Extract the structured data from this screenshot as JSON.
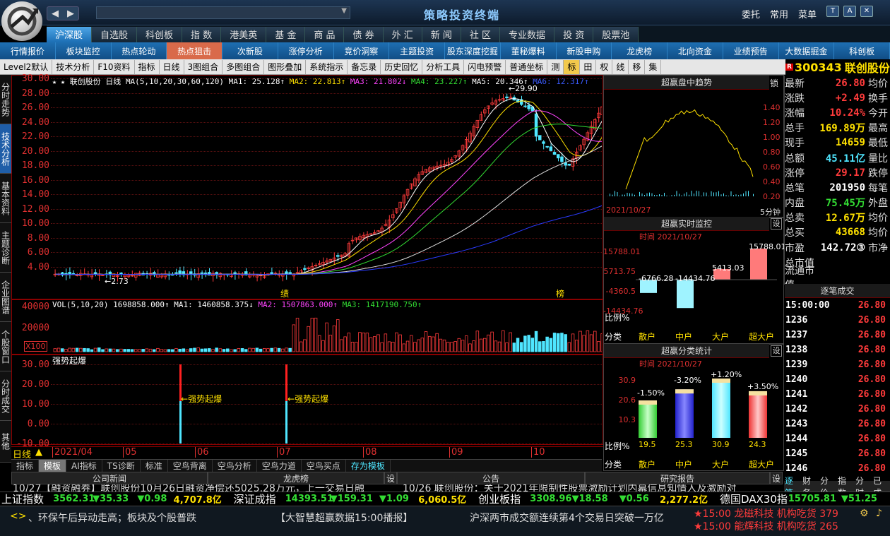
{
  "app": {
    "title": "策略投资终端"
  },
  "top_menu": [
    "委托",
    "常用",
    "菜单"
  ],
  "market_tabs": [
    "沪深股",
    "自选股",
    "科创板",
    "指  数",
    "港美英",
    "基  金",
    "商  品",
    "债  券",
    "外  汇",
    "新  闻",
    "社  区",
    "专业数据",
    "投  资",
    "股票池"
  ],
  "market_active": 0,
  "func_tabs": [
    "行情报价",
    "板块监控",
    "热点轮动",
    "热点狙击",
    "次新股",
    "涨停分析",
    "竞价洞察",
    "主题投资",
    "股东深度挖掘",
    "董秘爆料",
    "新股申购",
    "龙虎榜",
    "北向资金",
    "业绩预告",
    "大数据掘金",
    "科创板"
  ],
  "func_active": 3,
  "toolbar": [
    "Level2默认",
    "技术分析",
    "F10资料",
    "指标",
    "日线",
    "3图组合",
    "多图组合",
    "图形叠加",
    "系统指示",
    "备忘录",
    "历史回忆",
    "分析工具",
    "闪电预警",
    "普通坐标",
    "测",
    "标",
    "田",
    "权",
    "线",
    "移",
    "集"
  ],
  "toolbar_active": 15,
  "stock": {
    "code": "300343",
    "name": "联创股份",
    "badge": "R"
  },
  "left_tabs": [
    "分时走势",
    "技术分析",
    "基本资料",
    "主题诊断",
    "企业图谱",
    "个股窗口",
    "分时成交",
    "其他"
  ],
  "left_active": 1,
  "kline": {
    "legend_prefix": "联创股份",
    "period": "日线",
    "ma_params": "MA(5,10,20,30,60,120)",
    "ma1": "MA1: 25.128↑",
    "ma2": "MA2: 22.813↑",
    "ma3": "MA3: 21.802↓",
    "ma4": "MA4: 23.227↑",
    "ma5": "MA5: 20.346↑",
    "ma6": "MA6: 12.317↑",
    "high_label": "29.90",
    "low_label": "2.73",
    "marker_a": "绩",
    "marker_b": "榜",
    "y_ticks": [
      "30.00",
      "28.00",
      "26.00",
      "24.00",
      "22.00",
      "20.00",
      "18.00",
      "16.00",
      "14.00",
      "12.00",
      "10.00",
      "8.00",
      "6.00",
      "4.00"
    ]
  },
  "volume": {
    "legend": "VOL(5,10,20) 1698858.000↑",
    "ma1": "MA1: 1460858.375↓",
    "ma2": "MA2: 1507863.000↑",
    "ma3": "MA3: 1417190.750↑",
    "y_ticks": [
      "40000",
      "20000"
    ],
    "unit": "X100"
  },
  "indicator": {
    "name": "强势起爆",
    "y_ticks": [
      "30.00",
      "20.00",
      "10.00",
      "0.00",
      "-10.00"
    ],
    "signal_label": "强势起爆"
  },
  "xaxis": {
    "period": "日线",
    "labels": [
      "2021/04",
      "05",
      "06",
      "07",
      "08",
      "09",
      "10"
    ]
  },
  "bottom_tabs": [
    "指标",
    "模板",
    "AI指标",
    "TS诊断",
    "标准",
    "空鸟背离",
    "空鸟分析",
    "空鸟力道",
    "空鸟买点",
    "存为模板"
  ],
  "bottom_active": 1,
  "intraday": {
    "title": "超赢盘中趋势",
    "lock": "锁",
    "date": "2021/10/27",
    "period": "5分钟",
    "right_ticks": [
      "1.40",
      "1.20",
      "1.00",
      "0.80",
      "0.60",
      "0.40",
      "0.20"
    ]
  },
  "monitor": {
    "title": "超赢实时监控",
    "time_label": "时间",
    "date": "2021/10/27",
    "setting": "设",
    "y_ticks": [
      "15788.01",
      "5713.75",
      "-4360.5",
      "-14434.76"
    ],
    "bars": [
      {
        "label": "散户",
        "value": "-6766.28",
        "v": -6766.28
      },
      {
        "label": "中户",
        "value": "-14434.76",
        "v": -14434.76
      },
      {
        "label": "大户",
        "value": "5413.03",
        "v": 5413.03
      },
      {
        "label": "超大户",
        "value": "15788.01",
        "v": 15788.01
      }
    ],
    "ratio_label": "比例%",
    "cat_label": "分类"
  },
  "classify": {
    "title": "超赢分类统计",
    "time_label": "时间",
    "date": "2021/10/27",
    "setting": "设",
    "y_ticks": [
      "30.9",
      "20.6",
      "10.3"
    ],
    "bars": [
      {
        "label": "散户",
        "pct": "19.5",
        "chg": "-1.50%",
        "v": 19.5
      },
      {
        "label": "中户",
        "pct": "25.3",
        "chg": "-3.20%",
        "v": 25.3
      },
      {
        "label": "大户",
        "pct": "30.9",
        "chg": "+1.20%",
        "v": 30.9
      },
      {
        "label": "超大户",
        "pct": "24.3",
        "chg": "+3.50%",
        "v": 24.3
      }
    ],
    "ratio_label": "比例%",
    "cat_label": "分类"
  },
  "quote": [
    {
      "k": "最新",
      "v": "26.80",
      "c": "red",
      "k2": "均价"
    },
    {
      "k": "涨跌",
      "v": "+2.49",
      "c": "red",
      "k2": "换手"
    },
    {
      "k": "涨幅",
      "v": "10.24%",
      "c": "red",
      "k2": "今开"
    },
    {
      "k": "总手",
      "v": "169.89万",
      "c": "yel",
      "k2": "最高"
    },
    {
      "k": "现手",
      "v": "14659",
      "c": "yel",
      "k2": "最低"
    },
    {
      "k": "总额",
      "v": "45.11亿",
      "c": "cyan",
      "k2": "量比"
    },
    {
      "k": "涨停",
      "v": "29.17",
      "c": "red",
      "k2": "跌停"
    },
    {
      "k": "总笔",
      "v": "201950",
      "c": "white",
      "k2": "每笔"
    },
    {
      "k": "内盘",
      "v": "75.45万",
      "c": "green",
      "k2": "外盘"
    },
    {
      "k": "总卖",
      "v": "12.67万",
      "c": "yel",
      "k2": "均价"
    },
    {
      "k": "总买",
      "v": "43668",
      "c": "yel",
      "k2": "均价"
    },
    {
      "k": "市盈",
      "v": "142.72③",
      "c": "white",
      "k2": "市净"
    },
    {
      "k": "总市值",
      "v": "",
      "c": "white",
      "k2": ""
    },
    {
      "k": "流通市值",
      "v": "",
      "c": "white",
      "k2": ""
    }
  ],
  "ticks": {
    "title": "逐笔成交",
    "rows": [
      {
        "t": "15:00:00",
        "p": "26.80"
      },
      {
        "t": "1236",
        "p": "26.80"
      },
      {
        "t": "1237",
        "p": "26.80"
      },
      {
        "t": "1238",
        "p": "26.80"
      },
      {
        "t": "1239",
        "p": "26.80"
      },
      {
        "t": "1240",
        "p": "26.80"
      },
      {
        "t": "1241",
        "p": "26.80"
      },
      {
        "t": "1242",
        "p": "26.80"
      },
      {
        "t": "1243",
        "p": "26.80"
      },
      {
        "t": "1244",
        "p": "26.80"
      },
      {
        "t": "1245",
        "p": "26.80"
      },
      {
        "t": "1246",
        "p": "26.80"
      }
    ],
    "tabs": [
      "逐笔",
      "财务",
      "分价",
      "指数",
      "分时",
      "已成"
    ]
  },
  "news": {
    "company_title": "公司新闻",
    "dragon_title": "龙虎榜",
    "notice_title": "公告",
    "research_title": "研究报告",
    "setting": "设",
    "company_text": "10/27【融资融券】联创股份10月26日融资净偿还5025.28万元，上一交易日融",
    "notice_text": "10/26 联创股份：关于2021年限制性股票激励计划内幕信息知情人及激励对"
  },
  "indices": [
    {
      "name": "上证指数",
      "val": "3562.31",
      "chg": "▼35.33",
      "pct": "▼0.98",
      "amt": "4,707.8亿"
    },
    {
      "name": "深证成指",
      "val": "14393.51",
      "chg": "▼159.31",
      "pct": "▼1.09",
      "amt": "6,060.5亿"
    },
    {
      "name": "创业板指",
      "val": "3308.96",
      "chg": "▼18.58",
      "pct": "▼0.56",
      "amt": "2,277.2亿"
    },
    {
      "name": "德国DAX30指数",
      "val": "15705.81",
      "chg": "▼51.25",
      "pct": "",
      "amt": ""
    }
  ],
  "scroll": {
    "text1": "、环保午后异动走高；板块及个股普跌",
    "text2": "【大智慧超赢数据15:00播报】",
    "text3": "沪深两市成交额连续第4个交易日突破一万亿",
    "alert1": "★15:00 龙磁科技 机构吃货 379",
    "alert2": "★15:00 能辉科技 机构吃货 265"
  }
}
